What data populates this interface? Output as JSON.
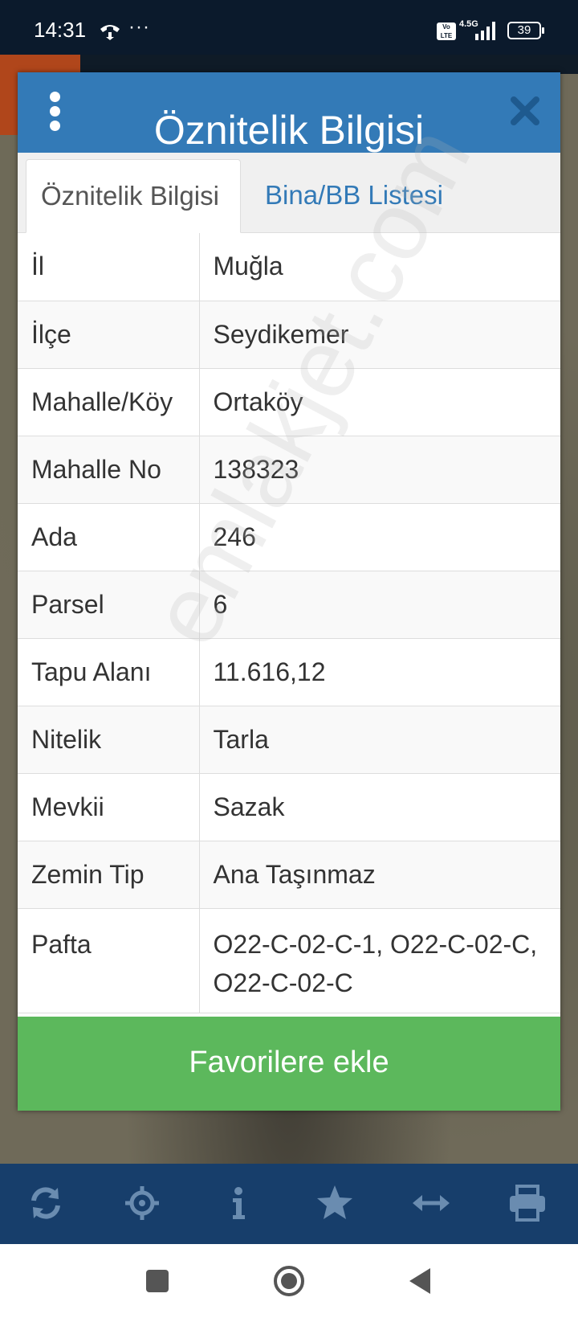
{
  "status": {
    "time": "14:31",
    "extra": "···",
    "volte": "Vo LTE",
    "network": "4.5G",
    "battery": "39"
  },
  "dialog": {
    "title": "Öznitelik Bilgisi",
    "tabs": [
      {
        "label": "Öznitelik Bilgisi",
        "active": true
      },
      {
        "label": "Bina/BB Listesi",
        "active": false
      }
    ],
    "rows": [
      {
        "key": "İl",
        "value": "Muğla"
      },
      {
        "key": "İlçe",
        "value": "Seydikemer"
      },
      {
        "key": "Mahalle/Köy",
        "value": "Ortaköy"
      },
      {
        "key": "Mahalle No",
        "value": "138323"
      },
      {
        "key": "Ada",
        "value": "246"
      },
      {
        "key": "Parsel",
        "value": "6"
      },
      {
        "key": "Tapu Alanı",
        "value": "11.616,12"
      },
      {
        "key": "Nitelik",
        "value": "Tarla"
      },
      {
        "key": "Mevkii",
        "value": "Sazak"
      },
      {
        "key": "Zemin Tip",
        "value": "Ana Taşınmaz"
      },
      {
        "key": "Pafta",
        "value": "O22-C-02-C-1,  O22-C-02-C, O22-C-02-C"
      }
    ],
    "favorite_button": "Favorilere ekle"
  },
  "watermark": "emlakjet.com",
  "toolbar": {
    "icons": [
      "refresh-icon",
      "locate-icon",
      "info-icon",
      "star-icon",
      "measure-icon",
      "print-icon"
    ]
  },
  "colors": {
    "header": "#337ab7",
    "button": "#5cb85c",
    "toolbar": "#173e6b"
  }
}
